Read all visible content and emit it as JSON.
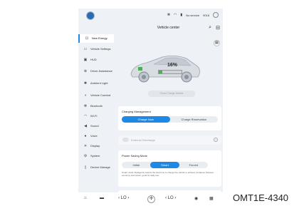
{
  "status_bar": {
    "icons": [
      "bluetooth-icon",
      "wifi-icon",
      "signal-icon"
    ],
    "network": "No service",
    "time": "9018",
    "badge": "5"
  },
  "header": {
    "title": "Vehicle center"
  },
  "sidebar": {
    "items": [
      {
        "label": "New Energy",
        "icon": "energy-icon",
        "active": true
      },
      {
        "label": "Vehicle Settings",
        "icon": "car-icon"
      },
      {
        "label": "HUD",
        "icon": "hud-icon"
      },
      {
        "label": "Driver Assistance",
        "icon": "steering-icon"
      },
      {
        "label": "Ambient Light",
        "icon": "light-icon"
      },
      {
        "label": "Vehicle Comfort",
        "icon": "seat-icon"
      },
      {
        "label": "Bluetooth",
        "icon": "bluetooth-icon"
      },
      {
        "label": "Wi-Fi",
        "icon": "wifi-icon"
      },
      {
        "label": "Sound",
        "icon": "speaker-icon"
      },
      {
        "label": "Voice",
        "icon": "microphone-icon"
      },
      {
        "label": "Display",
        "icon": "sun-icon"
      },
      {
        "label": "System",
        "icon": "gear-icon"
      },
      {
        "label": "Device Manage",
        "icon": "device-icon"
      }
    ]
  },
  "energy": {
    "charge_percent_text": "16%",
    "charge_fraction": 0.16,
    "charge_info_label": "Show Charge Details"
  },
  "charging": {
    "title": "Charging Management",
    "options": [
      "Charge Now",
      "Charge Reservation"
    ],
    "selected": "Charge Now"
  },
  "discharge": {
    "label": "External Discharge"
  },
  "power_saving": {
    "title": "Power Saving Mode",
    "options": [
      "Initial",
      "Smart",
      "Forced"
    ],
    "selected": "Smart",
    "description": "Smart mode intelligently selects the best time to charge the vehicle to achieve a balance between economy and power, good for daily use."
  },
  "bottom_bar": {
    "left_temp": "LO",
    "right_temp": "LO"
  },
  "watermark": "OMT1E-4340",
  "colors": {
    "accent": "#1e88e5",
    "battery_fill": "#4caf50",
    "screen_bg": "#eef1f5"
  }
}
